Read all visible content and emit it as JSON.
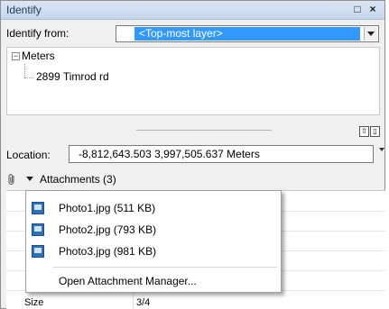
{
  "window": {
    "title": "Identify",
    "restore_glyph": "□",
    "close_glyph": "×"
  },
  "identify_from": {
    "label": "Identify from:",
    "selected": "<Top-most layer>"
  },
  "tree": {
    "toggle": "−",
    "root": "Meters",
    "child": "2899 Timrod rd"
  },
  "location": {
    "label": "Location:",
    "value": "-8,812,643.503  3,997,505.637 Meters"
  },
  "attachments": {
    "label": "Attachments (3)",
    "items": [
      {
        "label": "Photo1.jpg (511 KB)"
      },
      {
        "label": "Photo2.jpg (793 KB)"
      },
      {
        "label": "Photo3.jpg (981 KB)"
      }
    ],
    "manager_label": "Open Attachment Manager..."
  },
  "fields": {
    "size_label": "Size",
    "size_value": "3/4"
  },
  "icons": {
    "clip": "paperclip-icon",
    "file": "image-file-icon"
  }
}
